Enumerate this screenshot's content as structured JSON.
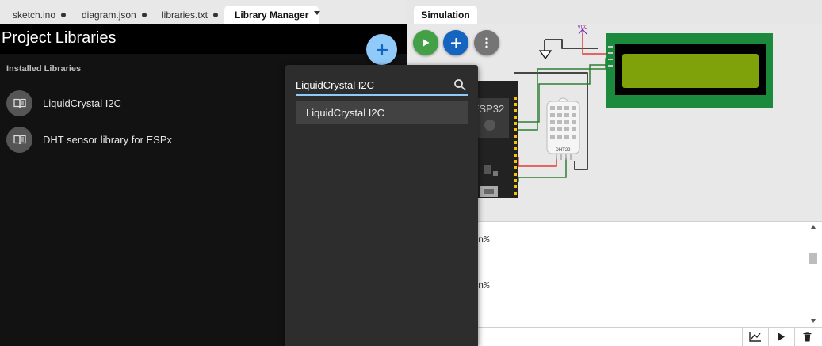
{
  "tabs": [
    {
      "label": "sketch.ino",
      "modified": true
    },
    {
      "label": "diagram.json",
      "modified": true
    },
    {
      "label": "libraries.txt",
      "modified": true
    },
    {
      "label": "Library Manager",
      "modified": false,
      "active": true
    }
  ],
  "library_manager": {
    "title": "Project Libraries",
    "add_icon": "plus-icon",
    "section_label": "Installed Libraries",
    "installed": [
      {
        "name": "LiquidCrystal I2C",
        "icon": "book-icon"
      },
      {
        "name": "DHT sensor library for ESPx",
        "icon": "book-icon"
      }
    ]
  },
  "search": {
    "value": "LiquidCrystal I2C",
    "icon": "search-icon",
    "results": [
      "LiquidCrystal I2C"
    ]
  },
  "simulation": {
    "tab_label": "Simulation",
    "controls": [
      {
        "icon": "play-icon",
        "color": "#43a047"
      },
      {
        "icon": "plus-icon",
        "color": "#1565c0"
      },
      {
        "icon": "more-vert-icon",
        "color": "#757575"
      }
    ],
    "components": {
      "vcc_label": "VCC",
      "board_label": "ESP32",
      "sensor_label": "DHT22"
    }
  },
  "serial_monitor": {
    "lines": [
      "n%",
      "n%"
    ],
    "bottom_icons": [
      "chart-icon",
      "play-icon",
      "trash-icon"
    ]
  },
  "colors": {
    "accent": "#90caf9",
    "lcd_board": "#1b8a3c",
    "lcd_screen": "#7fa10a",
    "wire_red": "#e53935",
    "wire_green": "#2e7d32"
  }
}
